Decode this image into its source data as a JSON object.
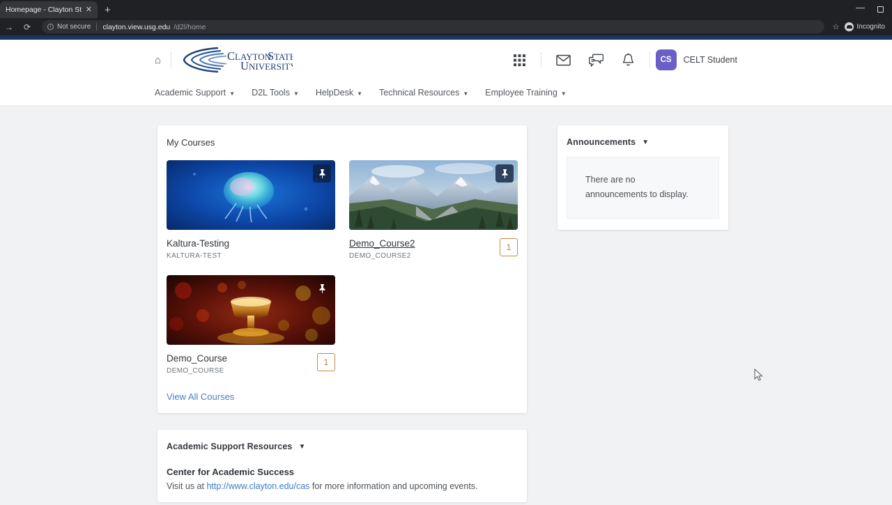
{
  "browser": {
    "tab_title": "Homepage - Clayton State Unive",
    "tab_close_icon": "close-icon",
    "new_tab_icon": "plus-icon",
    "minimize_icon": "minimize-icon",
    "maximize_icon": "maximize-icon",
    "forward_icon": "forward-arrow-icon",
    "reload_icon": "reload-icon",
    "info_icon": "info-icon",
    "security_label": "Not secure",
    "url_host": "clayton.view.usg.edu",
    "url_path": "/d2l/home",
    "bookmark_icon": "star-icon",
    "profile_label": "Incognito"
  },
  "header": {
    "home_icon": "home-icon",
    "logo_line1": "Clayton State",
    "logo_line2": "University",
    "waffle_icon": "apps-grid-icon",
    "mail_icon": "envelope-icon",
    "chat_icon": "chat-bubbles-icon",
    "bell_icon": "notification-bell-icon",
    "avatar_initials": "CS",
    "user_name": "CELT Student",
    "avatar_color": "#6b5fc7"
  },
  "nav": {
    "items": [
      {
        "label": "Academic Support"
      },
      {
        "label": "D2L Tools"
      },
      {
        "label": "HelpDesk"
      },
      {
        "label": "Technical Resources"
      },
      {
        "label": "Employee Training"
      }
    ]
  },
  "my_courses": {
    "title": "My Courses",
    "view_all_label": "View All Courses",
    "pin_icon": "pushpin-icon",
    "courses": [
      {
        "name": "Kaltura-Testing",
        "code": "KALTURA-TEST",
        "image": "jellyfish-blue-ocean",
        "pinned": true,
        "pin_box": true,
        "badge": "",
        "underlined": false
      },
      {
        "name": "Demo_Course2",
        "code": "DEMO_COURSE2",
        "image": "mountain-valley-landscape",
        "pinned": true,
        "pin_box": true,
        "badge": "1",
        "underlined": true
      },
      {
        "name": "Demo_Course",
        "code": "DEMO_COURSE",
        "image": "amber-bokeh-glass-goblet",
        "pinned": true,
        "pin_box": false,
        "badge": "1",
        "underlined": false
      }
    ],
    "badge_color": "#c98a4b"
  },
  "announcements": {
    "title": "Announcements",
    "collapse_icon": "chevron-down-icon",
    "empty_line1": "There are no",
    "empty_line2": "announcements to display."
  },
  "academic_support": {
    "title": "Academic Support Resources",
    "collapse_icon": "chevron-down-icon",
    "heading": "Center for Academic Success",
    "text_before": "Visit us at ",
    "link": "http://www.clayton.edu/cas",
    "text_after": " for more information and upcoming events."
  }
}
